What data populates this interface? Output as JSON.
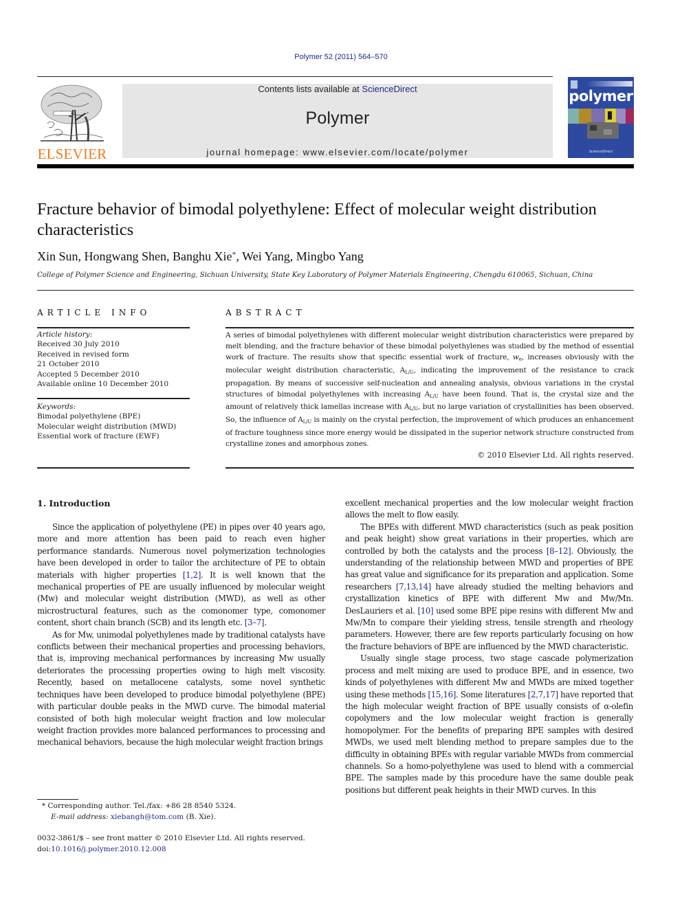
{
  "header": {
    "citation": "Polymer 52 (2011) 564–570",
    "contents_prefix": "Contents lists available at ",
    "contents_link": "ScienceDirect",
    "journal_name": "Polymer",
    "homepage": "journal homepage: www.elsevier.com/locate/polymer",
    "publisher_logo": "ELSEVIER",
    "cover_title": "polymer"
  },
  "article": {
    "title": "Fracture behavior of bimodal polyethylene: Effect of molecular weight distribution characteristics",
    "authors_before": "Xin Sun, Hongwang Shen, Banghu Xie",
    "authors_star": "*",
    "authors_after": ", Wei Yang, Mingbo Yang",
    "affiliation": "College of Polymer Science and Engineering, Sichuan University, State Key Laboratory of Polymer Materials Engineering, Chengdu 610065, Sichuan, China"
  },
  "article_info": {
    "heading": "ARTICLE INFO",
    "history_label": "Article history:",
    "history": [
      "Received 30 July 2010",
      "Received in revised form",
      "21 October 2010",
      "Accepted 5 December 2010",
      "Available online 10 December 2010"
    ],
    "keywords_label": "Keywords:",
    "keywords": [
      "Bimodal polyethylene (BPE)",
      "Molecular weight distribution (MWD)",
      "Essential work of fracture (EWF)"
    ]
  },
  "abstract": {
    "heading": "ABSTRACT",
    "parts": [
      "A series of bimodal polyethylenes with different molecular weight distribution characteristics were prepared by melt blending, and the fracture behavior of these bimodal polyethylenes was studied by the method of essential work of fracture. The results show that specific essential work of fracture, ",
      "w",
      "e",
      ", increases obviously with the molecular weight distribution characteristic, A",
      "L/U",
      ", indicating the improvement of the resistance to crack propagation. By means of successive self-nucleation and annealing analysis, obvious variations in the crystal structures of bimodal polyethylenes with increasing A",
      "L/U",
      " have been found. That is, the crystal size and the amount of relatively thick lamellas increase with A",
      "L/U",
      ", but no large variation of crystallinities has been observed. So, the influence of A",
      "L/U",
      " is mainly on the crystal perfection, the improvement of which produces an enhancement of fracture toughness since more energy would be dissipated in the superior network structure constructed from crystalline zones and amorphous zones."
    ],
    "copyright": "© 2010 Elsevier Ltd. All rights reserved."
  },
  "body": {
    "section_heading": "1.  Introduction",
    "col1": {
      "p1": [
        "Since the application of polyethylene (PE) in pipes over 40 years ago, more and more attention has been paid to reach even higher performance standards. Numerous novel polymerization technologies have been developed in order to tailor the architecture of PE to obtain materials with higher properties ",
        "[1,2]",
        ". It is well known that the mechanical properties of PE are usually influenced by molecular weight (Mw) and molecular weight distribution (MWD), as well as other microstructural features, such as the comonomer type, comonomer content, short chain branch (SCB) and its length etc. ",
        "[3–7]",
        "."
      ],
      "p2": "As for Mw, unimodal polyethylenes made by traditional catalysts have conflicts between their mechanical properties and processing behaviors, that is, improving mechanical performances by increasing Mw usually deteriorates the processing properties owing to high melt viscosity. Recently, based on metallocene catalysts, some novel synthetic techniques have been developed to produce bimodal polyethylene (BPE) with particular double peaks in the MWD curve. The bimodal material consisted of both high molecular weight fraction and low molecular weight fraction provides more balanced performances to processing and mechanical behaviors, because the high molecular weight fraction brings"
    },
    "col2": {
      "p0": "excellent mechanical properties and the low molecular weight fraction allows the melt to flow easily.",
      "p1": [
        "The BPEs with different MWD characteristics (such as peak position and peak height) show great variations in their properties, which are controlled by both the catalysts and the process ",
        "[8–12]",
        ". Obviously, the understanding of the relationship between MWD and properties of BPE has great value and significance for its preparation and application. Some researchers ",
        "[7,13,14]",
        " have already studied the melting behaviors and crystallization kinetics of BPE with different Mw and Mw/Mn. DesLauriers et al. ",
        "[10]",
        " used some BPE pipe resins with different Mw and Mw/Mn to compare their yielding stress, tensile strength and rheology parameters. However, there are few reports particularly focusing on how the fracture behaviors of BPE are influenced by the MWD characteristic."
      ],
      "p2": [
        "Usually single stage process, two stage cascade polymerization process and melt mixing are used to produce BPE, and in essence, two kinds of polyethylenes with different Mw and MWDs are mixed together using these methods ",
        "[15,16]",
        ". Some literatures ",
        "[2,7,17]",
        " have reported that the high molecular weight fraction of BPE usually consists of α-olefin copolymers and the low molecular weight fraction is generally homopolymer. For the benefits of preparing BPE samples with desired MWDs, we used melt blending method to prepare samples due to the difficulty in obtaining BPEs with regular variable MWDs from commercial channels. So a homo-polyethylene was used to blend with a commercial BPE. The samples made by this procedure have the same double peak positions but different peak heights in their MWD curves. In this"
      ]
    }
  },
  "footnote": {
    "star": "*",
    "corresponding": " Corresponding author. Tel./fax: +86 28 8540 5324.",
    "email_label": "E-mail address: ",
    "email": "xiebangh@tom.com",
    "email_suffix": " (B. Xie)."
  },
  "front_matter": {
    "issn_line": "0032-3861/$ – see front matter © 2010 Elsevier Ltd. All rights reserved.",
    "doi_prefix": "doi:",
    "doi": "10.1016/j.polymer.2010.12.008"
  },
  "colors": {
    "link": "#1f2a88",
    "elsevier_orange": "#f07a1a",
    "cover_blue": "#2d4aa0",
    "banner_gray": "#e6e6e6"
  }
}
